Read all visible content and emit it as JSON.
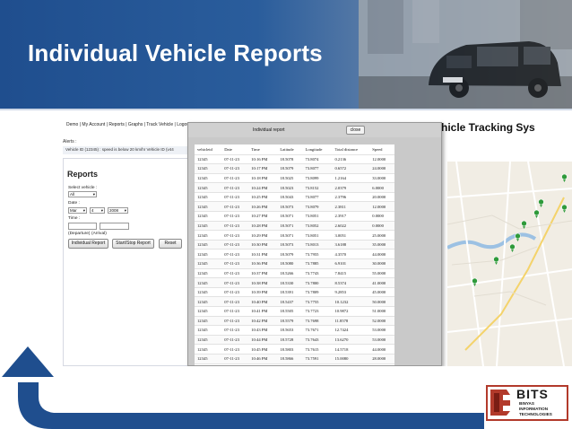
{
  "slide_title": "Individual Vehicle Reports",
  "nav": "Demo | My Account | Reports | Graphs | Track Vehicle | Logout |",
  "app_title": "hicle Tracking Sys",
  "alerts_label": "Alerts :",
  "alert_message": "Vehicle ID (12345) : speed is below 20 km/hr Vehicle ID (v44",
  "reports": {
    "heading": "Reports",
    "select_vehicle_label": "Select vehicle :",
    "vehicle_value": "All",
    "date_label": "Date :",
    "date_month": "Mar",
    "date_day": "4",
    "date_year": "2008",
    "time_label": "Time :",
    "departure_label": "(Departure)",
    "arrival_label": "(Arrival)",
    "buttons": {
      "individual": "Individual Report",
      "start_stop": "Start/Stop Report",
      "reset": "Reset"
    }
  },
  "report_window": {
    "title": "Individual report",
    "close_label": "close",
    "columns": [
      "vehicleid",
      "Date",
      "Time",
      "Latitude",
      "Longitude",
      "Total distance",
      "Speed"
    ],
    "rows": [
      [
        "12345",
        "07-11-23",
        "10:16 PM",
        "18.5078",
        "73.8074",
        "0.2136",
        "12.0000"
      ],
      [
        "12345",
        "07-11-23",
        "10:17 PM",
        "18.5079",
        "73.8077",
        "0.6572",
        "24.0000"
      ],
      [
        "12345",
        "07-11-23",
        "10:18 PM",
        "18.5025",
        "73.8099",
        "1.2164",
        "33.0000"
      ],
      [
        "12345",
        "07-11-23",
        "10:24 PM",
        "18.5023",
        "73.8152",
        "2.0379",
        "6.0000"
      ],
      [
        "12345",
        "07-11-23",
        "10:25 PM",
        "18.5043",
        "73.8077",
        "2.3796",
        "20.0000"
      ],
      [
        "12345",
        "07-11-23",
        "10:26 PM",
        "18.5073",
        "73.8079",
        "2.3811",
        "12.0000"
      ],
      [
        "12345",
        "07-11-23",
        "10:27 PM",
        "18.5071",
        "73.8051",
        "2.3917",
        "0.0000"
      ],
      [
        "12345",
        "07-11-23",
        "10:28 PM",
        "18.5071",
        "73.8052",
        "2.6022",
        "0.0000"
      ],
      [
        "12345",
        "07-11-23",
        "10:29 PM",
        "18.5071",
        "73.8051",
        "3.0051",
        "25.0000"
      ],
      [
        "12345",
        "07-11-23",
        "10:30 PM",
        "18.5073",
        "73.8013",
        "3.6188",
        "35.0000"
      ],
      [
        "12345",
        "07-11-23",
        "10:31 PM",
        "18.5079",
        "73.7955",
        "4.3570",
        "44.0000"
      ],
      [
        "12345",
        "07-11-23",
        "10:36 PM",
        "18.5080",
        "73.7885",
        "6.9101",
        "30.0000"
      ],
      [
        "12345",
        "07-11-23",
        "10:37 PM",
        "18.5266",
        "73.7743",
        "7.8415",
        "55.0000"
      ],
      [
        "12345",
        "07-11-23",
        "10:38 PM",
        "18.5330",
        "73.7800",
        "8.5374",
        "41.0000"
      ],
      [
        "12345",
        "07-11-23",
        "10:39 PM",
        "18.5391",
        "73.7809",
        "9.2853",
        "45.0000"
      ],
      [
        "12345",
        "07-11-23",
        "10:40 PM",
        "18.5437",
        "73.7755",
        "10.1232",
        "50.0000"
      ],
      [
        "12345",
        "07-11-23",
        "10:41 PM",
        "18.5505",
        "73.7723",
        "10.9872",
        "51.0000"
      ],
      [
        "12345",
        "07-11-23",
        "10:42 PM",
        "18.5579",
        "73.7698",
        "11.8578",
        "52.0000"
      ],
      [
        "12345",
        "07-11-23",
        "10:43 PM",
        "18.5653",
        "73.7671",
        "12.7424",
        "53.0000"
      ],
      [
        "12345",
        "07-11-23",
        "10:44 PM",
        "18.5728",
        "73.7643",
        "13.6270",
        "53.0000"
      ],
      [
        "12345",
        "07-11-23",
        "10:45 PM",
        "18.5803",
        "73.7615",
        "14.5718",
        "44.0000"
      ],
      [
        "12345",
        "07-11-23",
        "10:46 PM",
        "18.5866",
        "73.7591",
        "15.0080",
        "28.0000"
      ]
    ]
  },
  "logo": {
    "name": "BITS",
    "line1": "BINYAS",
    "line2": "INFORMATION",
    "line3": "TECHNOLOGIES"
  },
  "colors": {
    "banner_blue": "#1f4e8e",
    "arrow_blue": "#1f4e8e",
    "logo_red": "#b23a2b",
    "map_marker": "#2e9a3a"
  }
}
